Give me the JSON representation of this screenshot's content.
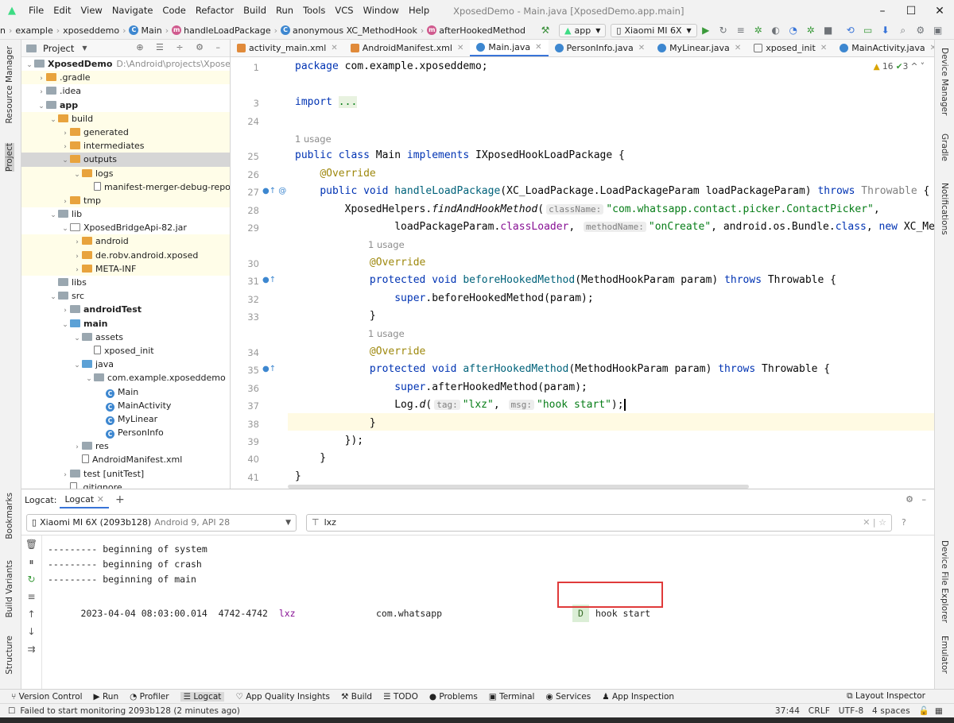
{
  "menu": [
    "File",
    "Edit",
    "View",
    "Navigate",
    "Code",
    "Refactor",
    "Build",
    "Run",
    "Tools",
    "VCS",
    "Window",
    "Help"
  ],
  "window_title": "XposedDemo - Main.java [XposedDemo.app.main]",
  "breadcrumb": [
    "n",
    "example",
    "xposeddemo",
    "Main",
    "handleLoadPackage",
    "anonymous XC_MethodHook",
    "afterHookedMethod"
  ],
  "toolbar": {
    "run_config": "app",
    "device": "Xiaomi MI 6X"
  },
  "left_strip": [
    "Resource Manager",
    "Project",
    "Bookmarks",
    "Build Variants",
    "Structure"
  ],
  "right_strip": [
    "Device Manager",
    "Gradle",
    "Notifications",
    "Device File Explorer",
    "Emulator"
  ],
  "project": {
    "title": "Project",
    "tree": [
      {
        "label": "XposedDemo",
        "extra": "D:\\Android\\projects\\XposedDe",
        "icon": "g",
        "bold": true
      },
      {
        "label": ".gradle",
        "icon": "f"
      },
      {
        "label": ".idea",
        "icon": "g"
      },
      {
        "label": "app",
        "icon": "g",
        "bold": true
      },
      {
        "label": "build",
        "icon": "f"
      },
      {
        "label": "generated",
        "icon": "f"
      },
      {
        "label": "intermediates",
        "icon": "f"
      },
      {
        "label": "outputs",
        "icon": "f"
      },
      {
        "label": "logs",
        "icon": "f"
      },
      {
        "label": "manifest-merger-debug-repor",
        "icon": "x"
      },
      {
        "label": "tmp",
        "icon": "f"
      },
      {
        "label": "lib",
        "icon": "g"
      },
      {
        "label": "XposedBridgeApi-82.jar",
        "icon": "j"
      },
      {
        "label": "android",
        "icon": "f"
      },
      {
        "label": "de.robv.android.xposed",
        "icon": "f"
      },
      {
        "label": "META-INF",
        "icon": "f"
      },
      {
        "label": "libs",
        "icon": "g"
      },
      {
        "label": "src",
        "icon": "g"
      },
      {
        "label": "androidTest",
        "icon": "g",
        "bold": true
      },
      {
        "label": "main",
        "icon": "b",
        "bold": true
      },
      {
        "label": "assets",
        "icon": "g"
      },
      {
        "label": "xposed_init",
        "icon": "x"
      },
      {
        "label": "java",
        "icon": "b"
      },
      {
        "label": "com.example.xposeddemo",
        "icon": "g"
      },
      {
        "label": "Main",
        "icon": "c"
      },
      {
        "label": "MainActivity",
        "icon": "c"
      },
      {
        "label": "MyLinear",
        "icon": "c"
      },
      {
        "label": "PersonInfo",
        "icon": "c"
      },
      {
        "label": "res",
        "icon": "g"
      },
      {
        "label": "AndroidManifest.xml",
        "icon": "x"
      },
      {
        "label": "test [unitTest]",
        "icon": "g"
      },
      {
        "label": ".gitignore",
        "icon": "x"
      }
    ]
  },
  "tabs": [
    "activity_main.xml",
    "AndroidManifest.xml",
    "Main.java",
    "PersonInfo.java",
    "MyLinear.java",
    "xposed_init",
    "MainActivity.java"
  ],
  "inspection": {
    "warnings": "16",
    "weak": "3"
  },
  "code_lines": [
    "1",
    "3",
    "24",
    "25",
    "26",
    "27",
    "28",
    "29",
    "30",
    "31",
    "32",
    "33",
    "34",
    "35",
    "36",
    "37",
    "38",
    "39",
    "40",
    "41"
  ],
  "usage_label": "1 usage",
  "logcat": {
    "tab_prefix": "Logcat:",
    "tab": "Logcat",
    "device": "Xiaomi MI 6X (2093b128)",
    "device_sub": "Android 9, API 28",
    "filter": "lxz",
    "lines": [
      "--------- beginning of system",
      "--------- beginning of crash",
      "--------- beginning of main"
    ],
    "entry": {
      "time": "2023-04-04 08:03:00.014",
      "pid": "4742-4742",
      "tag": "lxz",
      "package": "com.whatsapp",
      "level": "D",
      "message": "hook start"
    }
  },
  "bottom_tools": [
    "Version Control",
    "Run",
    "Profiler",
    "Logcat",
    "App Quality Insights",
    "Build",
    "TODO",
    "Problems",
    "Terminal",
    "Services",
    "App Inspection"
  ],
  "layout_inspector": "Layout Inspector",
  "status": {
    "message": "Failed to start monitoring 2093b128 (2 minutes ago)",
    "position": "37:44",
    "line_sep": "CRLF",
    "encoding": "UTF-8",
    "indent": "4 spaces"
  }
}
